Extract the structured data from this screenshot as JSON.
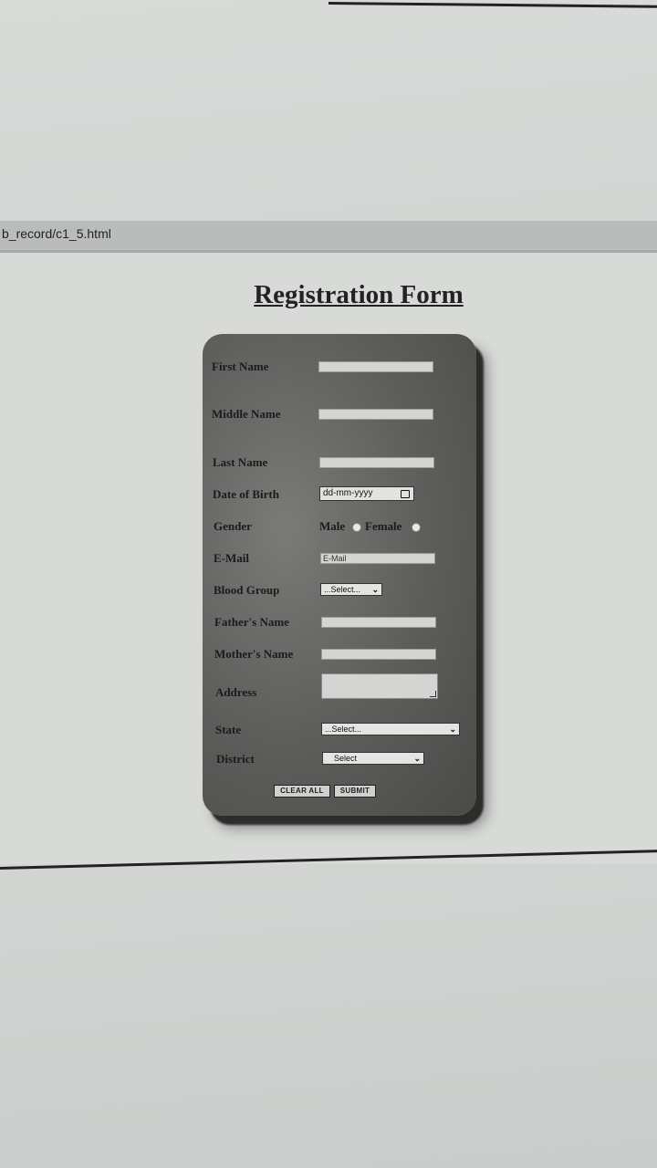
{
  "browser": {
    "address": "b_record/c1_5.html"
  },
  "page": {
    "title": "Registration Form"
  },
  "form": {
    "first_name": {
      "label": "First Name",
      "value": ""
    },
    "middle_name": {
      "label": "Middle Name",
      "value": ""
    },
    "last_name": {
      "label": "Last Name",
      "value": ""
    },
    "dob": {
      "label": "Date of Birth",
      "placeholder": "dd-mm-yyyy"
    },
    "gender": {
      "label": "Gender",
      "options": [
        "Male",
        "Female"
      ]
    },
    "email": {
      "label": "E-Mail",
      "placeholder": "E-Mail"
    },
    "blood_group": {
      "label": "Blood Group",
      "selected": "...Select..."
    },
    "father_name": {
      "label": "Father's Name",
      "value": ""
    },
    "mother_name": {
      "label": "Mother's Name",
      "value": ""
    },
    "address": {
      "label": "Address",
      "value": ""
    },
    "state": {
      "label": "State",
      "selected": "...Select..."
    },
    "district": {
      "label": "District",
      "selected": "Select"
    },
    "buttons": {
      "clear": "CLEAR ALL",
      "submit": "SUBMIT"
    }
  }
}
